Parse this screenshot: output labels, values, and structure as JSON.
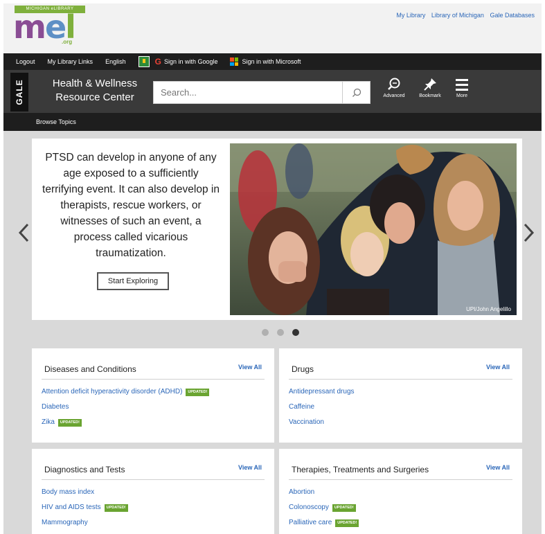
{
  "header": {
    "logo": {
      "tagline": "MICHIGAN eLIBRARY",
      "text_m": "m",
      "text_e": "e",
      "text_l": "l",
      "domain": ".org"
    },
    "top_links": [
      "My Library",
      "Library of Michigan",
      "Gale Databases"
    ]
  },
  "util_bar": {
    "logout": "Logout",
    "my_library_links": "My Library Links",
    "language": "English",
    "google_signin": "Sign in with Google",
    "microsoft_signin": "Sign in with Microsoft"
  },
  "app_bar": {
    "brand": "GALE",
    "title_line1": "Health & Wellness",
    "title_line2": "Resource Center",
    "search_placeholder": "Search...",
    "tools": {
      "advanced": "Advanced",
      "bookmark": "Bookmark",
      "more": "More"
    }
  },
  "browse_bar": {
    "label": "Browse Topics"
  },
  "carousel": {
    "text": "PTSD can develop in anyone of any age exposed to a sufficiently terrifying event. It can also develop in therapists, rescue workers, or witnesses of such an event, a process called vicarious traumatization.",
    "button": "Start Exploring",
    "photo_credit": "UPI/John Angelillo",
    "dot_count": 3,
    "active_dot": 3
  },
  "cards": [
    {
      "title": "Diseases and Conditions",
      "view_all": "View All",
      "items": [
        {
          "label": "Attention deficit hyperactivity disorder (ADHD)",
          "badge": "UPDATED!"
        },
        {
          "label": "Diabetes",
          "badge": ""
        },
        {
          "label": "Zika",
          "badge": "UPDATED!"
        }
      ]
    },
    {
      "title": "Drugs",
      "view_all": "View All",
      "items": [
        {
          "label": "Antidepressant drugs",
          "badge": ""
        },
        {
          "label": "Caffeine",
          "badge": ""
        },
        {
          "label": "Vaccination",
          "badge": ""
        }
      ]
    },
    {
      "title": "Diagnostics and Tests",
      "view_all": "View All",
      "items": [
        {
          "label": "Body mass index",
          "badge": ""
        },
        {
          "label": "HIV and AIDS tests",
          "badge": "UPDATED!"
        },
        {
          "label": "Mammography",
          "badge": ""
        }
      ]
    },
    {
      "title": "Therapies, Treatments and Surgeries",
      "view_all": "View All",
      "items": [
        {
          "label": "Abortion",
          "badge": ""
        },
        {
          "label": "Colonoscopy",
          "badge": "UPDATED!"
        },
        {
          "label": "Palliative care",
          "badge": "UPDATED!"
        }
      ]
    }
  ],
  "colors": {
    "link_blue": "#2a66b8",
    "badge_green": "#6aa431",
    "dark_bar": "#1e1e1e",
    "app_bar": "#3a3a3a",
    "content_bg": "#d9d9d9"
  }
}
